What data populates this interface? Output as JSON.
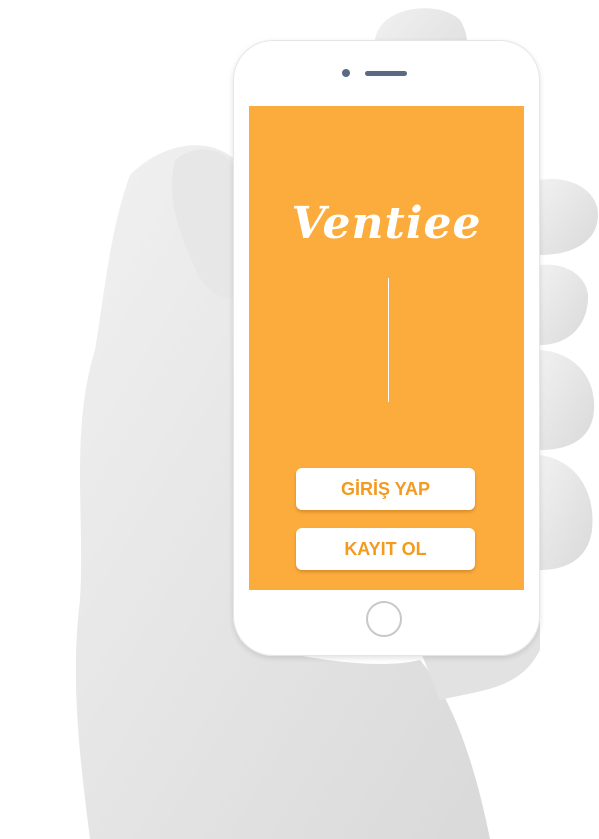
{
  "app": {
    "logo_text": "Ventiee"
  },
  "buttons": {
    "login_label": "GİRİŞ YAP",
    "register_label": "KAYIT OL"
  },
  "colors": {
    "screen_background": "#fcac3d",
    "button_text": "#f39a1f",
    "button_background": "#ffffff"
  }
}
